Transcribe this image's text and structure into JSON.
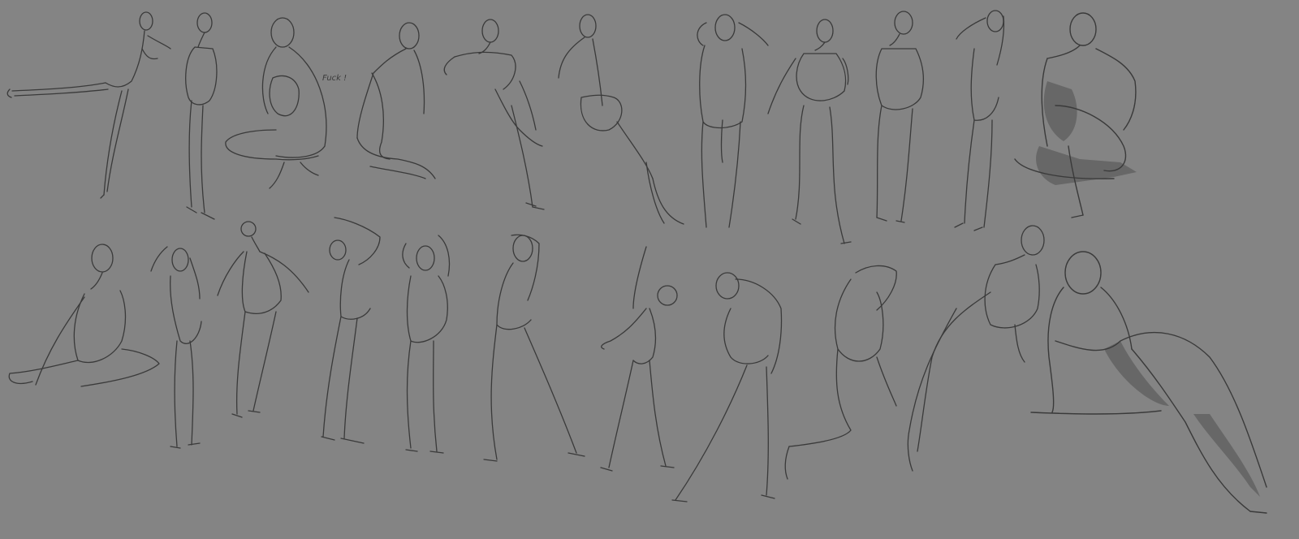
{
  "canvas": {
    "background": "#848484",
    "ink": "#3a3a3a"
  },
  "annotation": {
    "text": "Fuck !"
  },
  "rows": [
    {
      "name": "top-row",
      "figures": [
        "balance-leg-raised",
        "standing-profile",
        "crouching",
        "seated-kneeling",
        "arching-back",
        "leaning-back-view",
        "arms-raised-back-view",
        "hands-at-chest",
        "standing-front",
        "hand-behind-head",
        "seated-shaded"
      ]
    },
    {
      "name": "bottom-row",
      "figures": [
        "seated-twisting",
        "standing-twist",
        "stick-gesture",
        "arm-up-hips",
        "arms-behind-head",
        "hand-on-head-stride",
        "stretching-arm-up",
        "leaning-forward",
        "lunging",
        "bending-reach",
        "reclining-shaded"
      ]
    }
  ]
}
